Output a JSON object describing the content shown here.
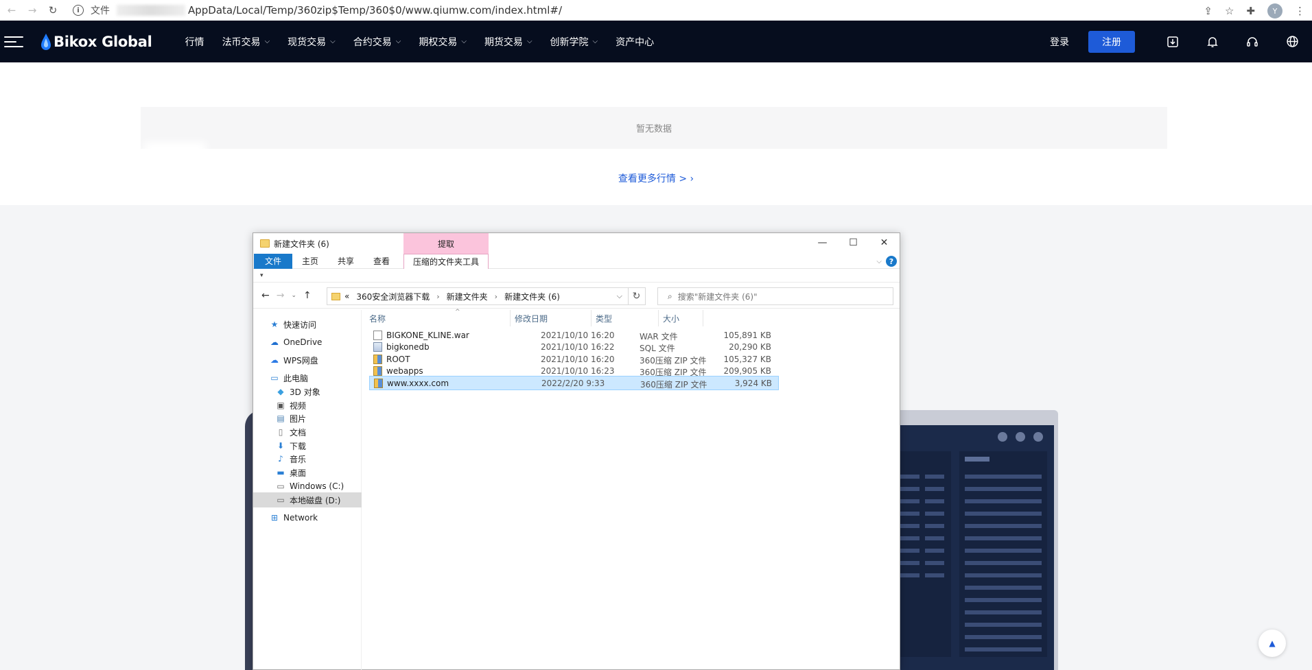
{
  "browser": {
    "scheme_label": "文件",
    "url_path": "AppData/Local/Temp/360zip$Temp/360$0/www.qiumw.com/index.html#/",
    "avatar_letter": "Y"
  },
  "site": {
    "brand": "Bikox Global",
    "nav": [
      {
        "label": "行情",
        "dropdown": false
      },
      {
        "label": "法币交易",
        "dropdown": true
      },
      {
        "label": "现货交易",
        "dropdown": true
      },
      {
        "label": "合约交易",
        "dropdown": true
      },
      {
        "label": "期权交易",
        "dropdown": true
      },
      {
        "label": "期货交易",
        "dropdown": true
      },
      {
        "label": "创新学院",
        "dropdown": true
      },
      {
        "label": "资产中心",
        "dropdown": false
      }
    ],
    "login_label": "登录",
    "register_label": "注册",
    "empty_text": "暂无数据",
    "more_link": "查看更多行情 >",
    "accent_color": "#1e5bd8",
    "header_bg": "#060d1e"
  },
  "explorer": {
    "window_title": "新建文件夹 (6)",
    "extract_label": "提取",
    "ribbon_tabs": [
      "文件",
      "主页",
      "共享",
      "查看"
    ],
    "zip_tools_label": "压缩的文件夹工具",
    "breadcrumb_prefix": "«",
    "breadcrumb": [
      "360安全浏览器下载",
      "新建文件夹",
      "新建文件夹 (6)"
    ],
    "search_placeholder": "搜索\"新建文件夹 (6)\"",
    "nav_pane": [
      {
        "label": "快速访问",
        "icon": "star-icon",
        "indent": 0,
        "selected": false
      },
      {
        "label": "OneDrive",
        "icon": "cloud-icon",
        "indent": 0,
        "selected": false
      },
      {
        "label": "WPS网盘",
        "icon": "wps-cloud-icon",
        "indent": 0,
        "selected": false
      },
      {
        "label": "此电脑",
        "icon": "computer-icon",
        "indent": 0,
        "selected": false
      },
      {
        "label": "3D 对象",
        "icon": "cube-icon",
        "indent": 1,
        "selected": false
      },
      {
        "label": "视频",
        "icon": "video-icon",
        "indent": 1,
        "selected": false
      },
      {
        "label": "图片",
        "icon": "picture-icon",
        "indent": 1,
        "selected": false
      },
      {
        "label": "文档",
        "icon": "document-icon",
        "indent": 1,
        "selected": false
      },
      {
        "label": "下载",
        "icon": "download-arrow-icon",
        "indent": 1,
        "selected": false
      },
      {
        "label": "音乐",
        "icon": "music-icon",
        "indent": 1,
        "selected": false
      },
      {
        "label": "桌面",
        "icon": "desktop-icon",
        "indent": 1,
        "selected": false
      },
      {
        "label": "Windows (C:)",
        "icon": "drive-icon",
        "indent": 1,
        "selected": false
      },
      {
        "label": "本地磁盘 (D:)",
        "icon": "drive-icon",
        "indent": 1,
        "selected": true
      },
      {
        "label": "Network",
        "icon": "network-icon",
        "indent": 0,
        "selected": false
      }
    ],
    "columns": [
      "名称",
      "修改日期",
      "类型",
      "大小"
    ],
    "files": [
      {
        "name": "BIGKONE_KLINE.war",
        "date": "2021/10/10 16:20",
        "type": "WAR 文件",
        "size": "105,891 KB",
        "icon": "doc",
        "selected": false
      },
      {
        "name": "bigkonedb",
        "date": "2021/10/10 16:22",
        "type": "SQL 文件",
        "size": "20,290 KB",
        "icon": "sql",
        "selected": false
      },
      {
        "name": "ROOT",
        "date": "2021/10/10 16:20",
        "type": "360压缩 ZIP 文件",
        "size": "105,327 KB",
        "icon": "zip",
        "selected": false
      },
      {
        "name": "webapps",
        "date": "2021/10/10 16:23",
        "type": "360压缩 ZIP 文件",
        "size": "209,905 KB",
        "icon": "zip",
        "selected": false
      },
      {
        "name": "www.xxxx.com",
        "date": "2022/2/20 9:33",
        "type": "360压缩 ZIP 文件",
        "size": "3,924 KB",
        "icon": "zip",
        "selected": true
      }
    ]
  }
}
